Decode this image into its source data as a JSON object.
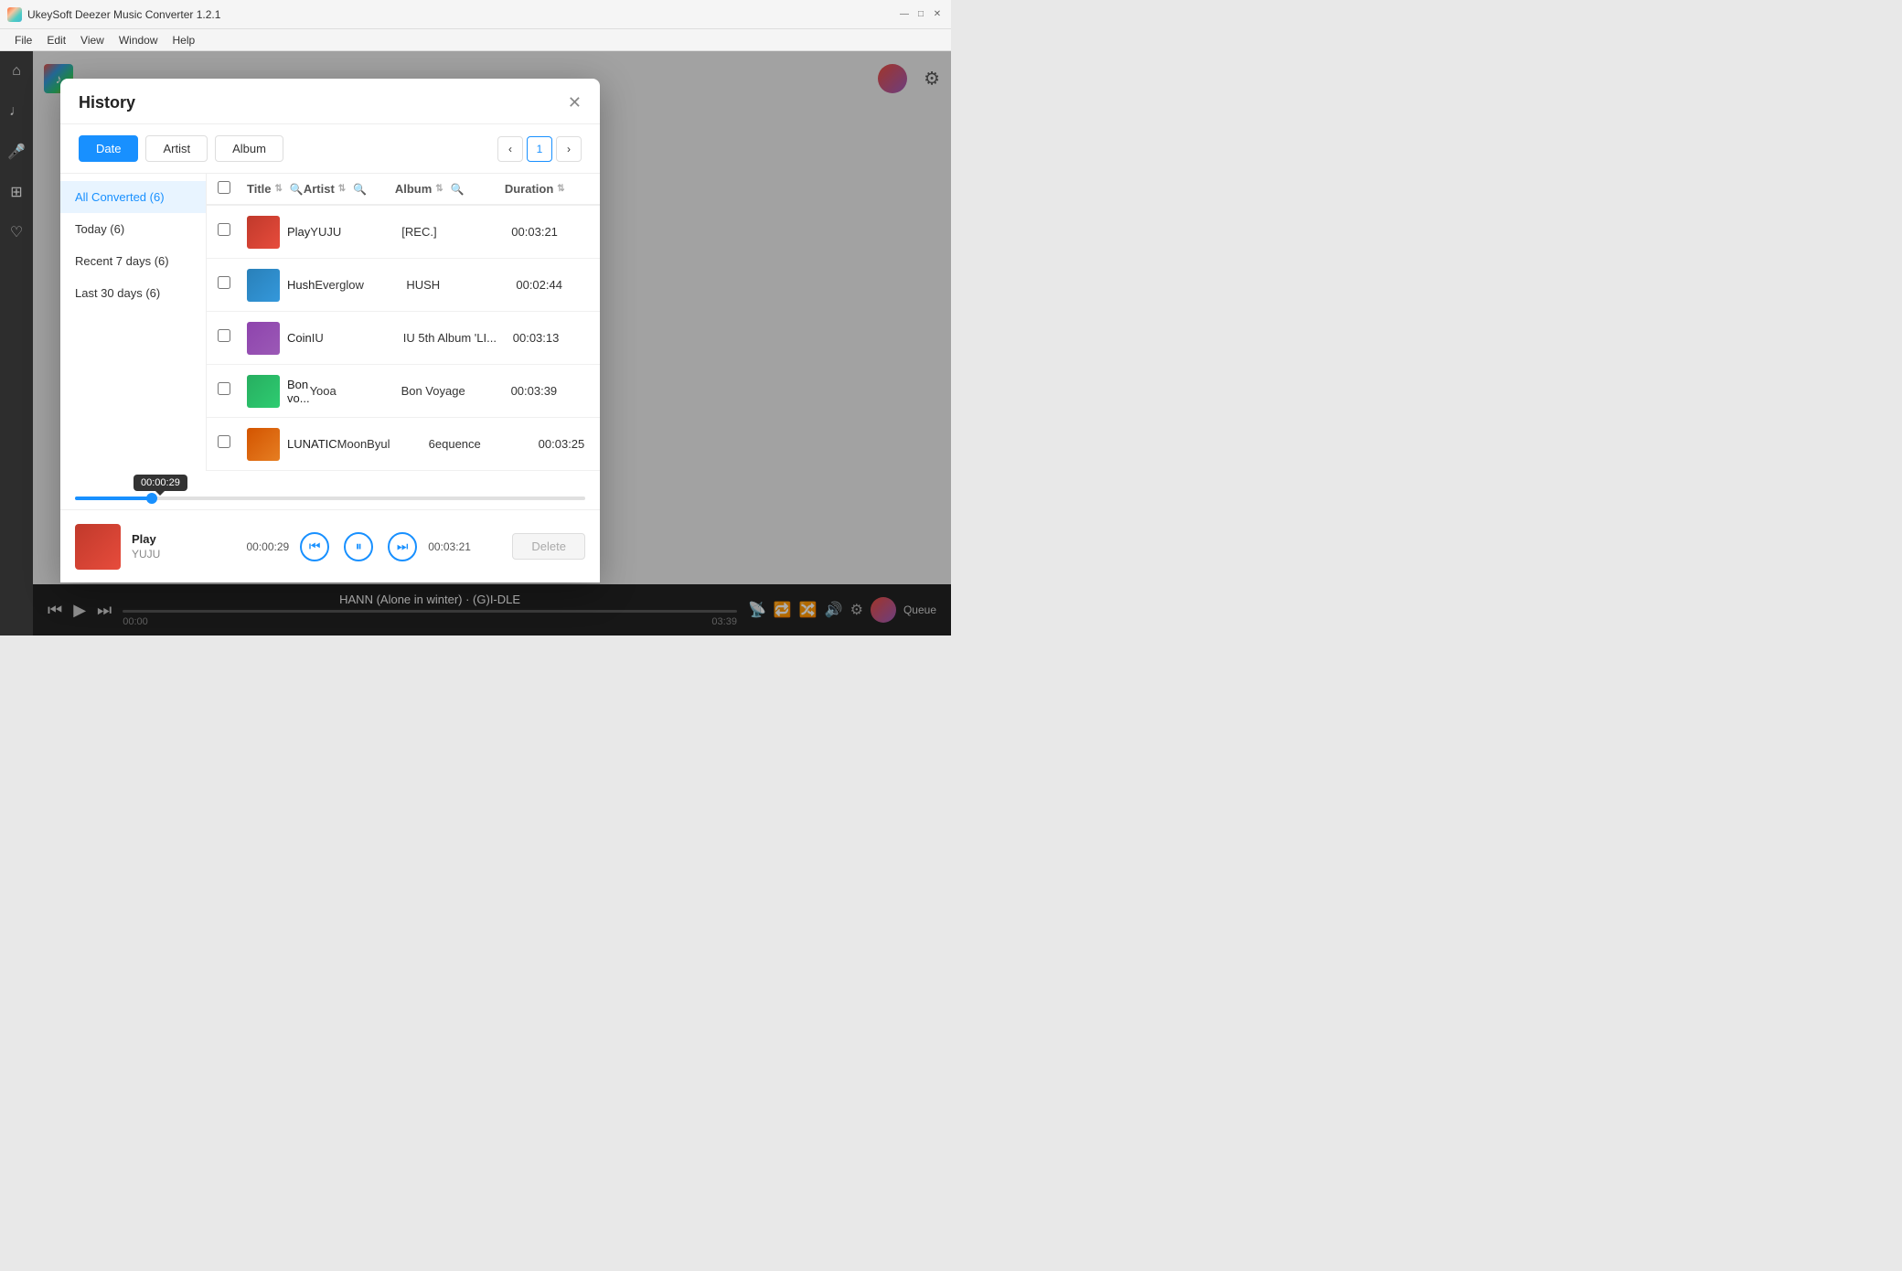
{
  "window": {
    "title": "UkeySoft Deezer Music Converter 1.2.1",
    "minimize": "—",
    "maximize": "□",
    "close": "✕"
  },
  "menu": {
    "items": [
      "File",
      "Edit",
      "View",
      "Window",
      "Help"
    ]
  },
  "dialog": {
    "title": "History",
    "close_label": "✕",
    "tabs": [
      "Date",
      "Artist",
      "Album"
    ],
    "active_tab": "Date",
    "page": "1",
    "nav_items": [
      {
        "label": "All Converted (6)",
        "active": true
      },
      {
        "label": "Today (6)",
        "active": false
      },
      {
        "label": "Recent 7 days (6)",
        "active": false
      },
      {
        "label": "Last 30 days (6)",
        "active": false
      }
    ],
    "table": {
      "columns": [
        {
          "label": "Title",
          "sortable": true,
          "searchable": true
        },
        {
          "label": "Artist",
          "sortable": true,
          "searchable": true
        },
        {
          "label": "Album",
          "sortable": true,
          "searchable": true
        },
        {
          "label": "Duration",
          "sortable": true
        }
      ],
      "rows": [
        {
          "title": "Play",
          "artist": "YUJU",
          "album": "[REC.]",
          "duration": "00:03:21",
          "thumb_color1": "#c0392b",
          "thumb_color2": "#e74c3c",
          "playing": true
        },
        {
          "title": "Hush",
          "artist": "Everglow",
          "album": "HUSH",
          "duration": "00:02:44",
          "thumb_color1": "#2980b9",
          "thumb_color2": "#3498db",
          "playing": false
        },
        {
          "title": "Coin",
          "artist": "IU",
          "album": "IU 5th Album 'LI...",
          "duration": "00:03:13",
          "thumb_color1": "#8e44ad",
          "thumb_color2": "#9b59b6",
          "playing": false
        },
        {
          "title": "Bon vo...",
          "artist": "Yooa",
          "album": "Bon Voyage",
          "duration": "00:03:39",
          "thumb_color1": "#27ae60",
          "thumb_color2": "#2ecc71",
          "playing": false
        },
        {
          "title": "LUNATIC",
          "artist": "MoonByul",
          "album": "6equence",
          "duration": "00:03:25",
          "thumb_color1": "#d35400",
          "thumb_color2": "#e67e22",
          "playing": false
        }
      ]
    },
    "player": {
      "title": "Play",
      "artist": "YUJU",
      "current_time": "00:00:29",
      "total_time": "00:03:21",
      "progress_percent": 15
    },
    "delete_btn": "Delete"
  },
  "progress_tooltip": "00:00:29",
  "transport": {
    "now_playing": "HANN (Alone in winter) · (G)I-DLE",
    "time_start": "00:00",
    "time_end": "03:39",
    "queue_label": "Queue"
  }
}
